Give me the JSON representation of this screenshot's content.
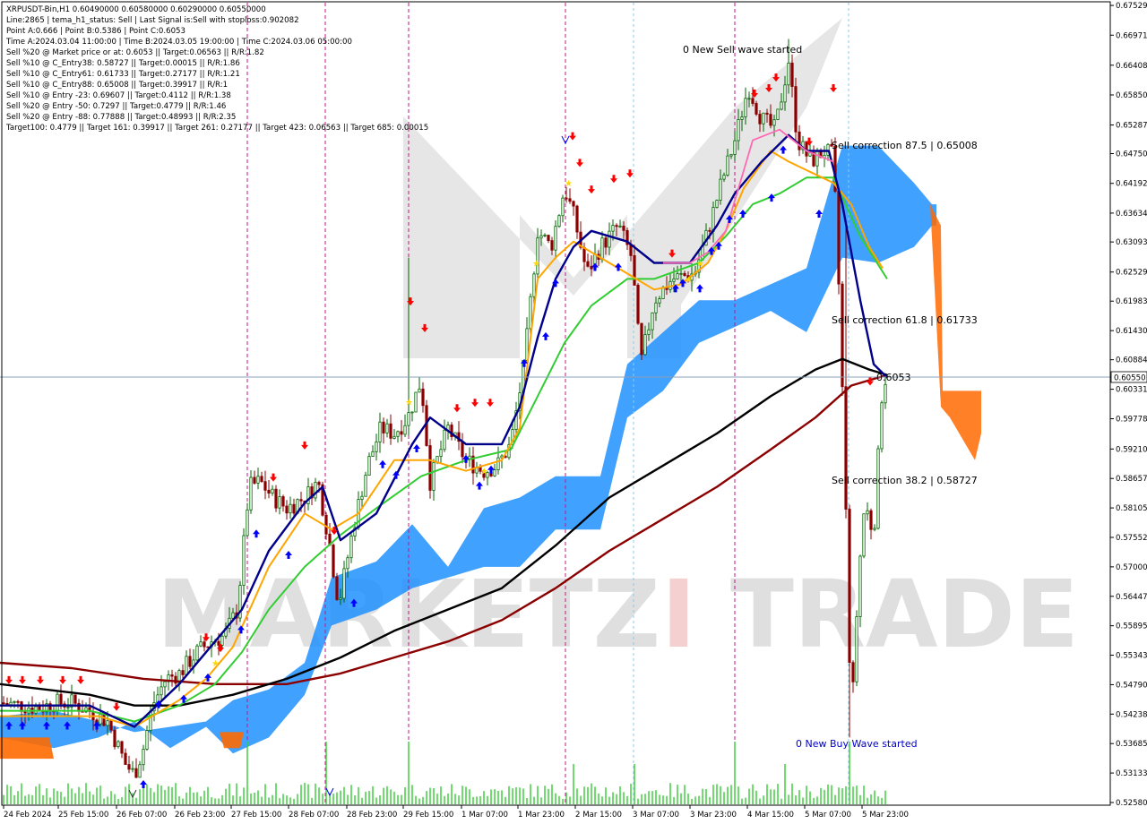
{
  "info": {
    "lines": [
      "XRPUSDT-Bin,H1  0.60490000 0.60580000 0.60290000 0.60550000",
      "Line:2865 | tema_h1_status: Sell | Last Signal is:Sell with stoploss:0.902082",
      "Point A:0.666 | Point B:0.5386 | Point C:0.6053",
      "Time A:2024.03.04 11:00:00 | Time B:2024.03.05 19:00:00 | Time C:2024.03.06 05:00:00",
      "Sell %20 @ Market price or at: 0.6053 || Target:0.06563 || R/R:1.82",
      "Sell %10 @ C_Entry38: 0.58727 || Target:0.00015 || R/R:1.86",
      "Sell %10 @ C_Entry61: 0.61733 || Target:0.27177 || R/R:1.21",
      "Sell %10 @ C_Entry88: 0.65008 || Target:0.39917 || R/R:1",
      "Sell %10 @ Entry -23: 0.69607 || Target:0.4112 || R/R:1.38",
      "Sell %20 @ Entry -50: 0.7297 || Target:0.4779 || R/R:1.46",
      "Sell %20 @ Entry -88: 0.77888 || Target:0.48993 || R/R:2.35",
      "Target100: 0.4779 || Target 161: 0.39917 || Target 261: 0.27177 || Target 423: 0.06563 || Target 685: 0.00015"
    ]
  },
  "annotations": {
    "sell_wave": "0 New Sell wave started",
    "buy_wave": "0 New Buy Wave started",
    "corr875": "Sell correction 87.5 | 0.65008",
    "corr618": "Sell correction 61.8 | 0.61733",
    "corr382": "Sell correction 38.2 | 0.58727",
    "price_label": "0.6053"
  },
  "current_price": "0.60550",
  "watermark": {
    "left": "MARKETZ",
    "mid": "I",
    "right": "TRADE"
  },
  "colors": {
    "bull_candle": "#006400",
    "bear_candle": "#8b0000",
    "cloud": "#1e90ff",
    "cloud_bear": "#ff6a00",
    "ma_fast": "#00008b",
    "ma_mid": "#32cd32",
    "ma_slow": "#000000",
    "ma_long": "#8b0000",
    "ma_orange": "#ffa500",
    "ma_pink": "#ff69b4",
    "volume": "#32cd32",
    "sell_arrow": "#ff0000",
    "buy_arrow": "#0000ff",
    "vline": "#c71585",
    "vline_dot": "#87ceeb"
  },
  "chart_data": {
    "type": "candlestick",
    "symbol": "XRPUSDT-Bin",
    "timeframe": "H1",
    "ylim": [
      0.5258,
      0.6753
    ],
    "y_ticks": [
      "0.67529",
      "0.66971",
      "0.66408",
      "0.65850",
      "0.65287",
      "0.64750",
      "0.64192",
      "0.63634",
      "0.63093",
      "0.62529",
      "0.61983",
      "0.61430",
      "0.60884",
      "0.60550",
      "0.60331",
      "0.59778",
      "0.59210",
      "0.58657",
      "0.58105",
      "0.57552",
      "0.57000",
      "0.56447",
      "0.55895",
      "0.55343",
      "0.54790",
      "0.54238",
      "0.53685",
      "0.53133",
      "0.52580"
    ],
    "x_labels": [
      "24 Feb 2024",
      "25 Feb 15:00",
      "26 Feb 07:00",
      "26 Feb 23:00",
      "27 Feb 15:00",
      "28 Feb 07:00",
      "28 Feb 23:00",
      "29 Feb 15:00",
      "1 Mar 07:00",
      "1 Mar 23:00",
      "2 Mar 15:00",
      "3 Mar 07:00",
      "3 Mar 23:00",
      "4 Mar 15:00",
      "5 Mar 07:00",
      "5 Mar 23:00"
    ],
    "price_anchors": [
      [
        0,
        0.5445
      ],
      [
        25,
        0.544
      ],
      [
        45,
        0.5435
      ],
      [
        60,
        0.5445
      ],
      [
        80,
        0.5445
      ],
      [
        100,
        0.543
      ],
      [
        120,
        0.541
      ],
      [
        140,
        0.533
      ],
      [
        150,
        0.531
      ],
      [
        160,
        0.536
      ],
      [
        170,
        0.544
      ],
      [
        185,
        0.549
      ],
      [
        200,
        0.55
      ],
      [
        220,
        0.554
      ],
      [
        235,
        0.556
      ],
      [
        250,
        0.557
      ],
      [
        265,
        0.562
      ],
      [
        278,
        0.585
      ],
      [
        290,
        0.586
      ],
      [
        305,
        0.583
      ],
      [
        320,
        0.581
      ],
      [
        340,
        0.583
      ],
      [
        355,
        0.586
      ],
      [
        368,
        0.574
      ],
      [
        378,
        0.563
      ],
      [
        395,
        0.578
      ],
      [
        410,
        0.589
      ],
      [
        425,
        0.596
      ],
      [
        440,
        0.595
      ],
      [
        455,
        0.598
      ],
      [
        470,
        0.605
      ],
      [
        480,
        0.586
      ],
      [
        500,
        0.596
      ],
      [
        520,
        0.59
      ],
      [
        540,
        0.588
      ],
      [
        555,
        0.589
      ],
      [
        570,
        0.593
      ],
      [
        585,
        0.608
      ],
      [
        600,
        0.633
      ],
      [
        615,
        0.63
      ],
      [
        630,
        0.641
      ],
      [
        640,
        0.636
      ],
      [
        655,
        0.625
      ],
      [
        670,
        0.63
      ],
      [
        690,
        0.634
      ],
      [
        705,
        0.628
      ],
      [
        715,
        0.608
      ],
      [
        730,
        0.62
      ],
      [
        750,
        0.624
      ],
      [
        775,
        0.625
      ],
      [
        790,
        0.633
      ],
      [
        805,
        0.642
      ],
      [
        820,
        0.65
      ],
      [
        835,
        0.66
      ],
      [
        850,
        0.654
      ],
      [
        865,
        0.652
      ],
      [
        880,
        0.665
      ],
      [
        890,
        0.65
      ],
      [
        905,
        0.646
      ],
      [
        920,
        0.648
      ],
      [
        930,
        0.647
      ],
      [
        938,
        0.615
      ],
      [
        944,
        0.58
      ],
      [
        950,
        0.54
      ],
      [
        958,
        0.568
      ],
      [
        965,
        0.582
      ],
      [
        975,
        0.576
      ],
      [
        985,
        0.605
      ],
      [
        990,
        0.6055
      ]
    ],
    "indicators": {
      "ma_fast": [
        [
          0,
          0.544
        ],
        [
          100,
          0.544
        ],
        [
          150,
          0.54
        ],
        [
          200,
          0.548
        ],
        [
          240,
          0.556
        ],
        [
          270,
          0.562
        ],
        [
          300,
          0.573
        ],
        [
          340,
          0.582
        ],
        [
          360,
          0.585
        ],
        [
          380,
          0.575
        ],
        [
          420,
          0.58
        ],
        [
          460,
          0.593
        ],
        [
          480,
          0.598
        ],
        [
          520,
          0.593
        ],
        [
          560,
          0.593
        ],
        [
          580,
          0.6
        ],
        [
          600,
          0.613
        ],
        [
          620,
          0.624
        ],
        [
          640,
          0.63
        ],
        [
          660,
          0.633
        ],
        [
          700,
          0.631
        ],
        [
          730,
          0.627
        ],
        [
          770,
          0.627
        ],
        [
          800,
          0.634
        ],
        [
          820,
          0.64
        ],
        [
          850,
          0.646
        ],
        [
          880,
          0.651
        ],
        [
          900,
          0.648
        ],
        [
          925,
          0.648
        ],
        [
          940,
          0.638
        ],
        [
          960,
          0.62
        ],
        [
          975,
          0.608
        ],
        [
          990,
          0.6055
        ]
      ],
      "ma_mid": [
        [
          0,
          0.543
        ],
        [
          100,
          0.543
        ],
        [
          150,
          0.541
        ],
        [
          200,
          0.544
        ],
        [
          240,
          0.548
        ],
        [
          270,
          0.554
        ],
        [
          300,
          0.562
        ],
        [
          340,
          0.57
        ],
        [
          380,
          0.576
        ],
        [
          420,
          0.581
        ],
        [
          470,
          0.587
        ],
        [
          520,
          0.59
        ],
        [
          570,
          0.592
        ],
        [
          600,
          0.602
        ],
        [
          630,
          0.612
        ],
        [
          660,
          0.619
        ],
        [
          700,
          0.624
        ],
        [
          730,
          0.624
        ],
        [
          780,
          0.627
        ],
        [
          810,
          0.632
        ],
        [
          840,
          0.638
        ],
        [
          870,
          0.64
        ],
        [
          900,
          0.643
        ],
        [
          930,
          0.643
        ],
        [
          960,
          0.632
        ],
        [
          990,
          0.624
        ]
      ],
      "ma_slow": [
        [
          0,
          0.548
        ],
        [
          100,
          0.546
        ],
        [
          150,
          0.544
        ],
        [
          200,
          0.544
        ],
        [
          260,
          0.546
        ],
        [
          320,
          0.549
        ],
        [
          380,
          0.553
        ],
        [
          440,
          0.558
        ],
        [
          500,
          0.562
        ],
        [
          560,
          0.566
        ],
        [
          620,
          0.574
        ],
        [
          680,
          0.583
        ],
        [
          740,
          0.589
        ],
        [
          800,
          0.595
        ],
        [
          860,
          0.602
        ],
        [
          910,
          0.607
        ],
        [
          940,
          0.609
        ],
        [
          970,
          0.607
        ],
        [
          990,
          0.606
        ]
      ],
      "ma_long": [
        [
          0,
          0.552
        ],
        [
          80,
          0.551
        ],
        [
          160,
          0.549
        ],
        [
          240,
          0.548
        ],
        [
          320,
          0.548
        ],
        [
          380,
          0.55
        ],
        [
          440,
          0.553
        ],
        [
          500,
          0.556
        ],
        [
          560,
          0.56
        ],
        [
          620,
          0.566
        ],
        [
          680,
          0.573
        ],
        [
          740,
          0.579
        ],
        [
          800,
          0.585
        ],
        [
          860,
          0.592
        ],
        [
          910,
          0.598
        ],
        [
          950,
          0.604
        ],
        [
          990,
          0.606
        ]
      ],
      "ma_orange": [
        [
          0,
          0.542
        ],
        [
          110,
          0.542
        ],
        [
          150,
          0.54
        ],
        [
          200,
          0.545
        ],
        [
          230,
          0.549
        ],
        [
          260,
          0.555
        ],
        [
          300,
          0.57
        ],
        [
          340,
          0.58
        ],
        [
          370,
          0.577
        ],
        [
          400,
          0.58
        ],
        [
          440,
          0.59
        ],
        [
          480,
          0.59
        ],
        [
          520,
          0.588
        ],
        [
          560,
          0.59
        ],
        [
          580,
          0.596
        ],
        [
          600,
          0.624
        ],
        [
          620,
          0.628
        ],
        [
          640,
          0.631
        ],
        [
          660,
          0.629
        ],
        [
          700,
          0.625
        ],
        [
          730,
          0.622
        ],
        [
          760,
          0.623
        ],
        [
          790,
          0.627
        ],
        [
          810,
          0.633
        ],
        [
          830,
          0.641
        ],
        [
          860,
          0.648
        ],
        [
          880,
          0.646
        ],
        [
          905,
          0.644
        ],
        [
          930,
          0.642
        ],
        [
          950,
          0.638
        ],
        [
          970,
          0.63
        ],
        [
          985,
          0.626
        ]
      ]
    }
  }
}
